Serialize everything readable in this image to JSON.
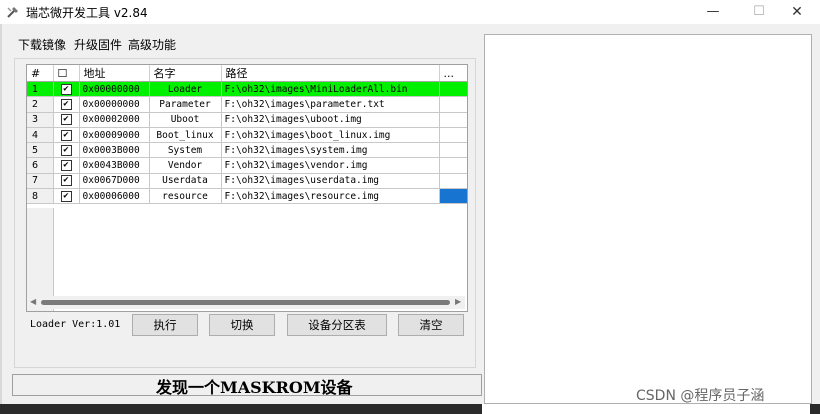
{
  "window": {
    "title": "瑞芯微开发工具 v2.84",
    "min_glyph": "—",
    "max_glyph": "☐",
    "close_glyph": "✕",
    "app_icon": "rockchip-tool-icon"
  },
  "tabs": [
    {
      "label": "下载镜像"
    },
    {
      "label": "升级固件"
    },
    {
      "label": "高级功能"
    }
  ],
  "grid": {
    "columns": [
      "#",
      "☐",
      "地址",
      "名字",
      "路径",
      "..."
    ],
    "rows": [
      {
        "num": "1",
        "checked": "✔",
        "address": "0x00000000",
        "name": "Loader",
        "path": "F:\\oh32\\images\\MiniLoaderAll.bin"
      },
      {
        "num": "2",
        "checked": "✔",
        "address": "0x00000000",
        "name": "Parameter",
        "path": "F:\\oh32\\images\\parameter.txt"
      },
      {
        "num": "3",
        "checked": "✔",
        "address": "0x00002000",
        "name": "Uboot",
        "path": "F:\\oh32\\images\\uboot.img"
      },
      {
        "num": "4",
        "checked": "✔",
        "address": "0x00009000",
        "name": "Boot_linux",
        "path": "F:\\oh32\\images\\boot_linux.img"
      },
      {
        "num": "5",
        "checked": "✔",
        "address": "0x0003B000",
        "name": "System",
        "path": "F:\\oh32\\images\\system.img"
      },
      {
        "num": "6",
        "checked": "✔",
        "address": "0x0043B000",
        "name": "Vendor",
        "path": "F:\\oh32\\images\\vendor.img"
      },
      {
        "num": "7",
        "checked": "✔",
        "address": "0x0067D000",
        "name": "Userdata",
        "path": "F:\\oh32\\images\\userdata.img"
      },
      {
        "num": "8",
        "checked": "✔",
        "address": "0x00006000",
        "name": "resource",
        "path": "F:\\oh32\\images\\resource.img"
      }
    ],
    "scroll_left": "◀",
    "scroll_right": "▶"
  },
  "loader_version": "Loader Ver:1.01",
  "buttons": {
    "execute": "执行",
    "switch": "切换",
    "partition_table": "设备分区表",
    "clear": "清空"
  },
  "status_text": "发现一个MASKROM设备",
  "watermark": "CSDN @程序员子涵",
  "colors": {
    "selected_row": "#00f000",
    "cell_highlight": "#1874d1"
  }
}
